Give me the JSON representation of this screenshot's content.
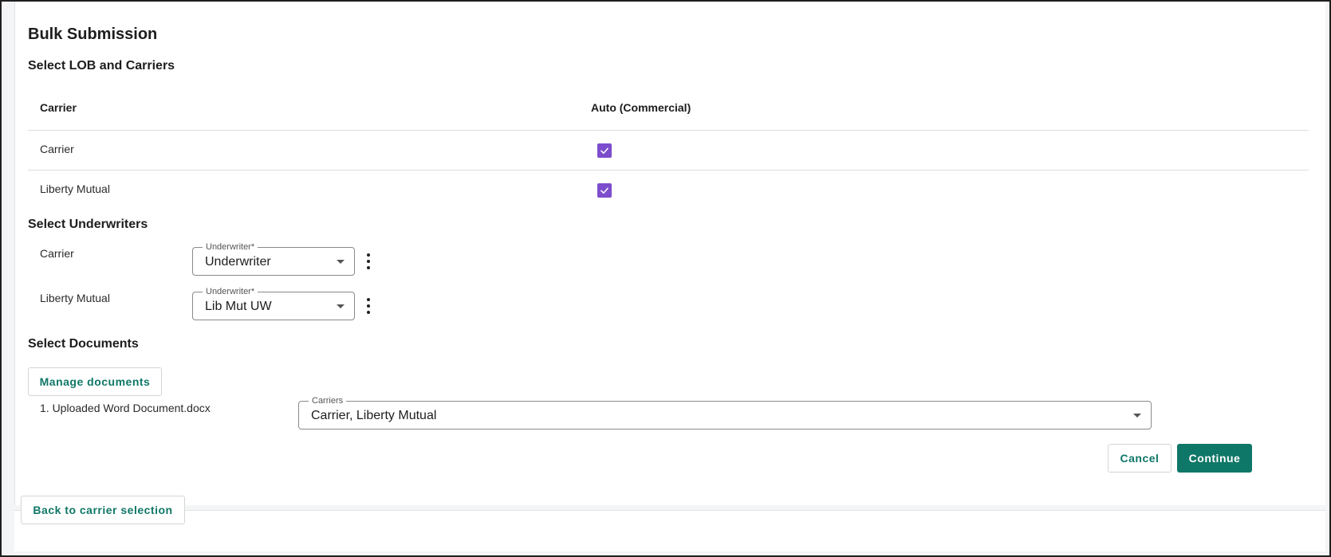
{
  "page": {
    "title": "Bulk Submission"
  },
  "lob_section": {
    "heading": "Select LOB and Carriers",
    "columns": [
      "Carrier",
      "Auto (Commercial)"
    ],
    "rows": [
      {
        "carrier": "Carrier",
        "checked": true
      },
      {
        "carrier": "Liberty Mutual",
        "checked": true
      }
    ]
  },
  "underwriters_section": {
    "heading": "Select Underwriters",
    "rows": [
      {
        "carrier": "Carrier",
        "field_label": "Underwriter*",
        "value": "Underwriter"
      },
      {
        "carrier": "Liberty Mutual",
        "field_label": "Underwriter*",
        "value": "Lib Mut UW"
      }
    ]
  },
  "documents_section": {
    "heading": "Select Documents",
    "manage_button": "Manage documents",
    "documents": [
      {
        "name": "1. Uploaded Word Document.docx",
        "field_label": "Carriers",
        "value": "Carrier, Liberty Mutual"
      }
    ]
  },
  "actions": {
    "cancel": "Cancel",
    "continue": "Continue"
  },
  "footer": {
    "back_button": "Back to carrier selection"
  },
  "colors": {
    "accent": "#0f7767",
    "checkbox": "#7c4dcc"
  }
}
